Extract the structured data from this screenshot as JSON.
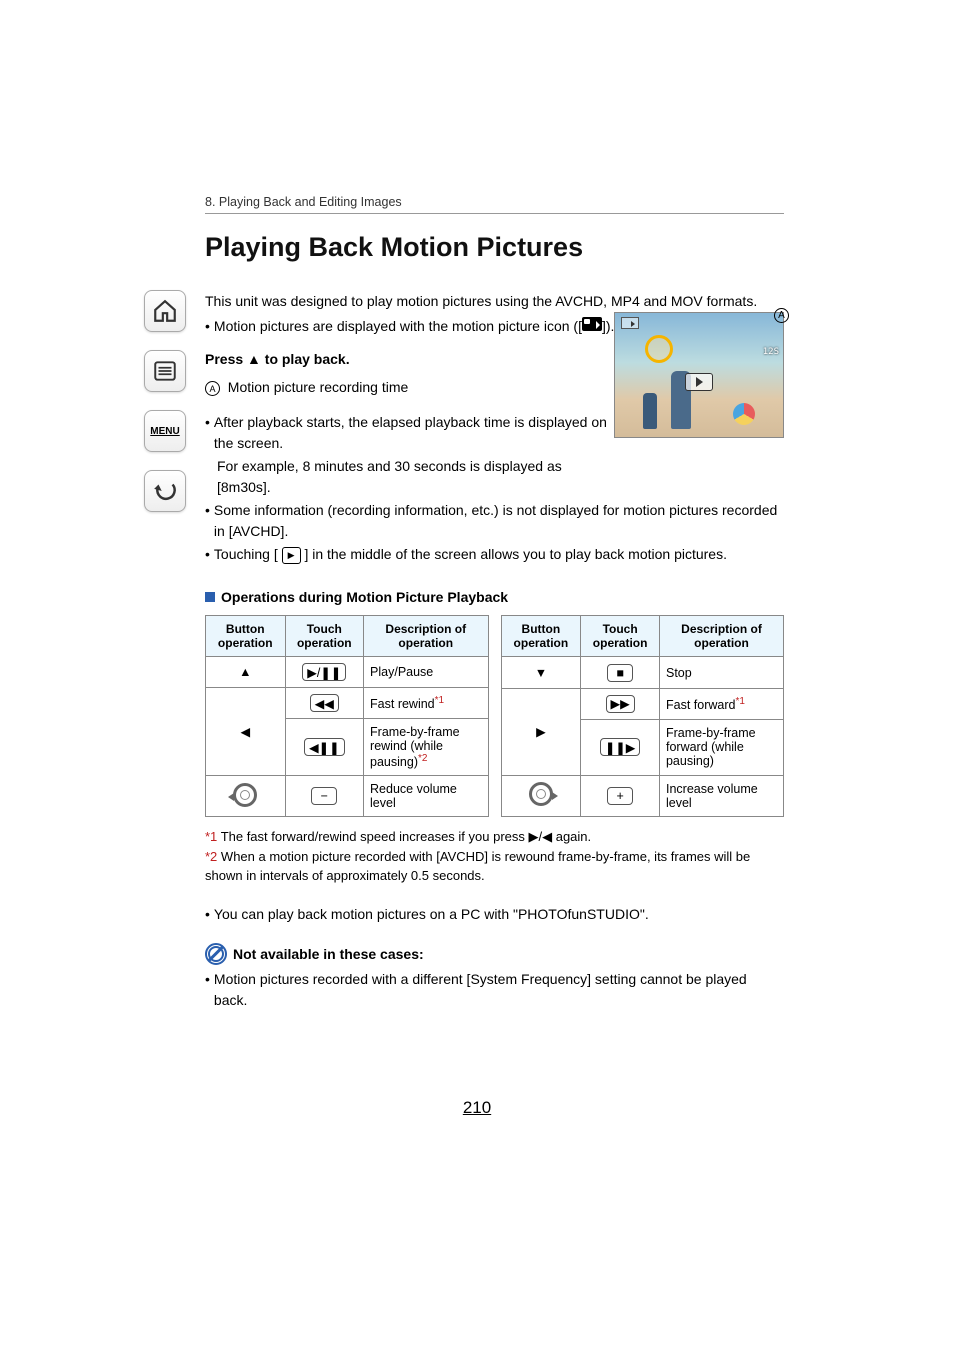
{
  "breadcrumb": "8. Playing Back and Editing Images",
  "title": "Playing Back Motion Pictures",
  "intro": "This unit was designed to play motion pictures using the AVCHD, MP4 and MOV formats.",
  "bullet_icon_note": "Motion pictures are displayed with the motion picture icon ([",
  "bullet_icon_note_end": "]).",
  "step": "Press ▲ to play back.",
  "marker_a_label": "Motion picture recording time",
  "preview_count": "12S",
  "after_playback": "After playback starts, the elapsed playback time is displayed on the screen.",
  "example_line": "For example, 8 minutes and 30 seconds is displayed as [8m30s].",
  "avchd_note": "Some information (recording information, etc.) is not displayed for motion pictures recorded in [AVCHD].",
  "touch_note_pre": "Touching [",
  "touch_note_post": "] in the middle of the screen allows you to play back motion pictures.",
  "section_head": "Operations during Motion Picture Playback",
  "headers": {
    "btn": "Button operation",
    "touch": "Touch operation",
    "desc": "Description of operation"
  },
  "rows_left": [
    {
      "btn": "▲",
      "touch": "▶/❚❚",
      "desc": "Play/Pause"
    },
    {
      "btn": "◀",
      "touch": "◀◀",
      "desc_pre": "Fast rewind",
      "sup": "*1"
    },
    {
      "btn": "",
      "touch": "◀❚❚",
      "desc_pre": "Frame-by-frame rewind (while pausing)",
      "sup": "*2"
    },
    {
      "btn": "dial-left",
      "touch": "−",
      "desc": "Reduce volume level"
    }
  ],
  "rows_right": [
    {
      "btn": "▼",
      "touch": "■",
      "desc": "Stop"
    },
    {
      "btn": "▶",
      "touch": "▶▶",
      "desc_pre": "Fast forward",
      "sup": "*1"
    },
    {
      "btn": "",
      "touch": "❚❚▶",
      "desc": "Frame-by-frame forward (while pausing)"
    },
    {
      "btn": "dial-right",
      "touch": "+",
      "desc": "Increase volume level"
    }
  ],
  "footnote1_sym": "*1",
  "footnote1": "The fast forward/rewind speed increases if you press ▶/◀ again.",
  "footnote2_sym": "*2",
  "footnote2": "When a motion picture recorded with [AVCHD] is rewound frame-by-frame, its frames will be shown in intervals of approximately 0.5 seconds.",
  "pc_note": "You can play back motion pictures on a PC with \"PHOTOfunSTUDIO\".",
  "na_head": "Not available in these cases:",
  "na_body": "Motion pictures recorded with a different [System Frequency] setting cannot be played back.",
  "page_number": "210",
  "sidebar_menu": "MENU"
}
